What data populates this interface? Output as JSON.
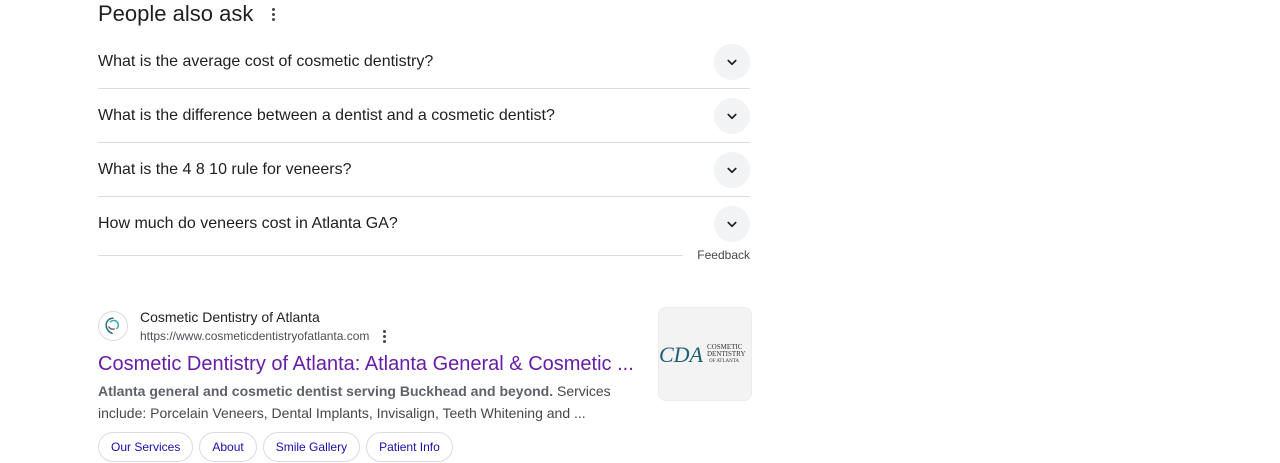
{
  "paa": {
    "title": "People also ask",
    "questions": [
      {
        "text": "What is the average cost of cosmetic dentistry?"
      },
      {
        "text": "What is the difference between a dentist and a cosmetic dentist?"
      },
      {
        "text": "What is the 4 8 10 rule for veneers?"
      },
      {
        "text": "How much do veneers cost in Atlanta GA?"
      }
    ],
    "feedback": "Feedback"
  },
  "result": {
    "site_name": "Cosmetic Dentistry of Atlanta",
    "url": "https://www.cosmeticdentistryofatlanta.com",
    "title": "Cosmetic Dentistry of Atlanta: Atlanta General & Cosmetic ...",
    "snippet_bold": "Atlanta general and cosmetic dentist serving Buckhead and beyond.",
    "snippet_rest": " Services include: Porcelain Veneers, Dental Implants, Invisalign, Teeth Whitening and ...",
    "thumbnail_logo": {
      "initials": "CDA",
      "line1": "COSMETIC",
      "line2": "DENTISTRY",
      "line3": "OF ATLANTA"
    },
    "sitelinks": [
      "Our Services",
      "About",
      "Smile Gallery",
      "Patient Info"
    ]
  },
  "colors": {
    "visited_link": "#681da8",
    "chip_link": "#1a0dab",
    "text": "#1f1f1f",
    "divider": "#dadce0",
    "chevron_bg": "#f1f3f4"
  },
  "icons": {
    "more": "kebab-menu-icon",
    "expand": "chevron-down-icon",
    "favicon": "tooth-logo-icon"
  }
}
